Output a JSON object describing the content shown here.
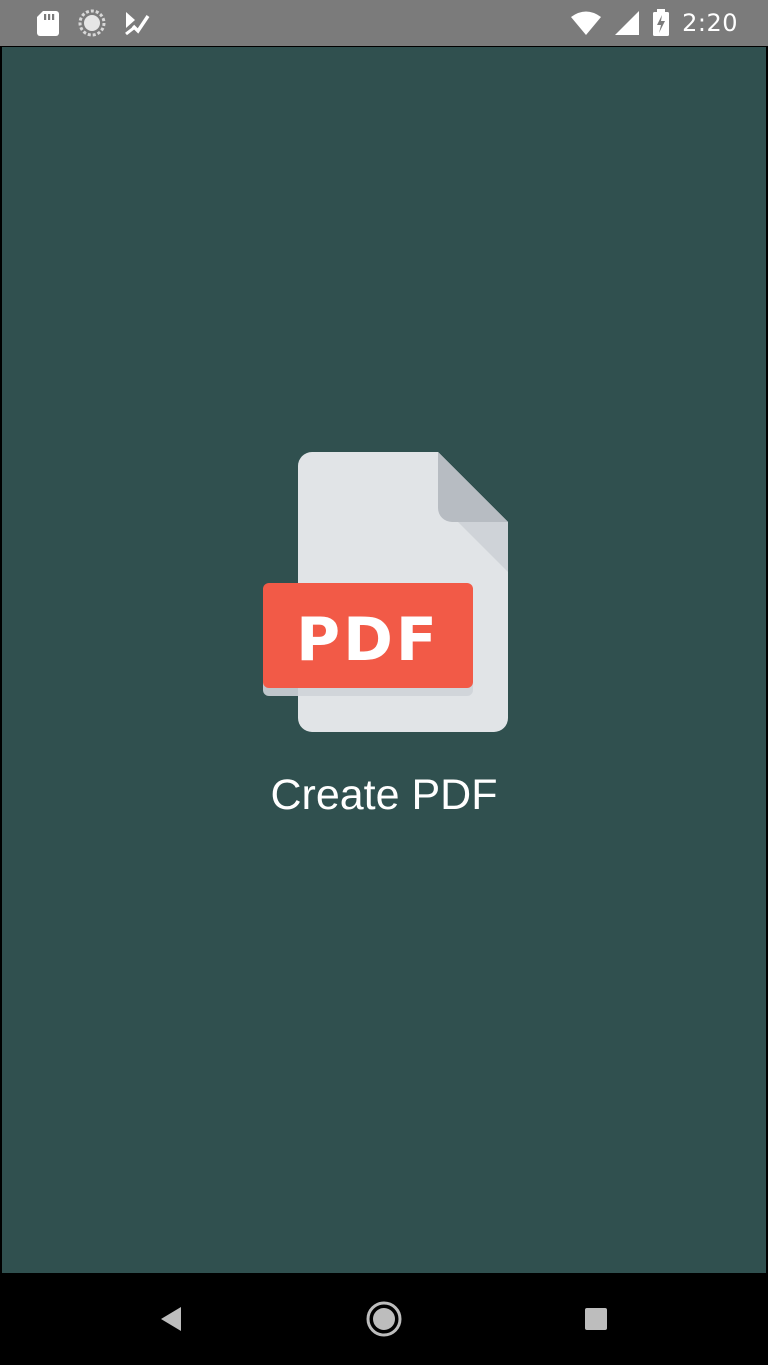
{
  "status_bar": {
    "time": "2:20",
    "left_icons": [
      "sd-card-icon",
      "sync-icon",
      "tasks-icon"
    ],
    "right_icons": [
      "wifi-icon",
      "cell-signal-icon",
      "battery-charging-icon"
    ]
  },
  "splash": {
    "badge_text": "PDF",
    "title": "Create PDF",
    "background_color": "#30504f",
    "badge_color": "#f25a47",
    "page_color": "#e1e4e7",
    "fold_color": "#b7bcc2"
  },
  "nav_bar": {
    "icons": [
      "back-icon",
      "home-icon",
      "recents-icon"
    ]
  }
}
